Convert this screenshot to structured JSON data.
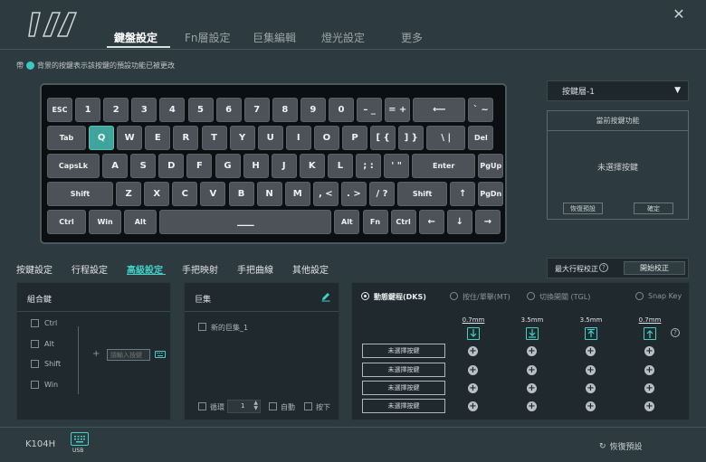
{
  "header": {
    "tabs": [
      {
        "label": "鍵盤設定",
        "active": true
      },
      {
        "label": "Fn層設定"
      },
      {
        "label": "巨集編輯"
      },
      {
        "label": "燈光設定"
      },
      {
        "label": "更多"
      }
    ],
    "close_icon": "close-icon"
  },
  "hint": {
    "prefix": "帶",
    "text": "背景的按鍵表示該按鍵的預設功能已被更改",
    "dot_color": "#38c9c2"
  },
  "keyboard": {
    "rows": [
      [
        "ESC",
        "1",
        "2",
        "3",
        "4",
        "5",
        "6",
        "7",
        "8",
        "9",
        "0",
        "–  _",
        "=  +",
        "⟵",
        "`  ~"
      ],
      [
        "Tab",
        "Q",
        "W",
        "E",
        "R",
        "T",
        "Y",
        "U",
        "I",
        "O",
        "P",
        "[  {",
        "]  }",
        "\\  |",
        "Del"
      ],
      [
        "CapsLk",
        "A",
        "S",
        "D",
        "F",
        "G",
        "H",
        "J",
        "K",
        "L",
        ";  :",
        "'  \"",
        "Enter",
        "PgUp"
      ],
      [
        "Shift",
        "Z",
        "X",
        "C",
        "V",
        "B",
        "N",
        "M",
        ",  <",
        ".  >",
        "/  ?",
        "Shift",
        "↑",
        "PgDn"
      ],
      [
        "Ctrl",
        "Win",
        "Alt",
        "▁▁▁",
        "Alt",
        "Fn",
        "Ctrl",
        "←",
        "↓",
        "→"
      ]
    ],
    "selected_key": "Q",
    "accent_color": "#3fa49c"
  },
  "right_panel": {
    "layer_select": "按鍵層-1",
    "function_box": {
      "title": "當前按鍵功能",
      "value": "未選擇按鍵",
      "restore_default": "恢復預設",
      "confirm": "確定"
    }
  },
  "sub_tabs": [
    {
      "label": "按鍵設定"
    },
    {
      "label": "行程設定"
    },
    {
      "label": "高級設定",
      "active": true
    },
    {
      "label": "手把映射"
    },
    {
      "label": "手把曲線"
    },
    {
      "label": "其他設定"
    }
  ],
  "travel": {
    "label": "最大行程校正",
    "button": "開始校正"
  },
  "combo": {
    "title": "組合鍵",
    "modifiers": [
      "Ctrl",
      "Alt",
      "Shift",
      "Win"
    ],
    "input_placeholder": "請輸入按鍵"
  },
  "macro": {
    "title": "巨集",
    "item": "新的巨集_1",
    "loop_label": "循環",
    "loop_value": "1",
    "auto_label": "自動",
    "press_label": "按下"
  },
  "dks": {
    "modes": [
      {
        "label": "動態鍵程(DKS)",
        "active": true
      },
      {
        "label": "按住/單擊(MT)"
      },
      {
        "label": "切換開關 (TGL)"
      },
      {
        "label": "Snap Key"
      }
    ],
    "columns": [
      "0.7mm",
      "3.5mm",
      "3.5mm",
      "0.7mm"
    ],
    "key_buttons": [
      "未選擇按鍵",
      "未選擇按鍵",
      "未選擇按鍵",
      "未選擇按鍵"
    ],
    "plus": "+"
  },
  "footer": {
    "model": "K104H",
    "usb_label": "USB",
    "restore": "恢復預設"
  }
}
